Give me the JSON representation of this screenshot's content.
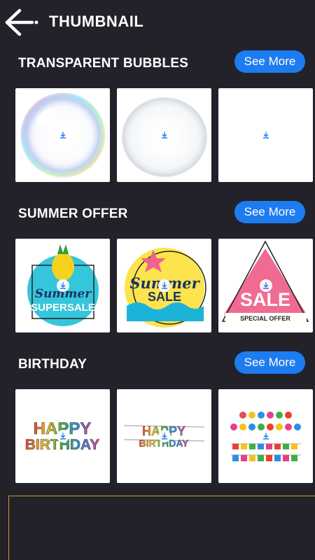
{
  "header": {
    "title": "THUMBNAIL",
    "back_icon": "arrow-left-icon"
  },
  "sections": [
    {
      "title": "TRANSPARENT BUBBLES",
      "see_more": "See More"
    },
    {
      "title": "SUMMER OFFER",
      "see_more": "See More"
    },
    {
      "title": "BIRTHDAY",
      "see_more": "See More"
    }
  ],
  "artwork_text": {
    "summer_supersale": [
      "Summer",
      "SUPERSALE"
    ],
    "summer_sale": [
      "Summer",
      "SALE"
    ],
    "sale_special": [
      "SALE",
      "SPECIAL OFFER"
    ],
    "happy_birthday": [
      "HAPPY",
      "BIRTHDAY"
    ]
  },
  "colors": {
    "accent": "#1d7cf0",
    "background": "#23212a",
    "ad_border": "#d49a20"
  }
}
